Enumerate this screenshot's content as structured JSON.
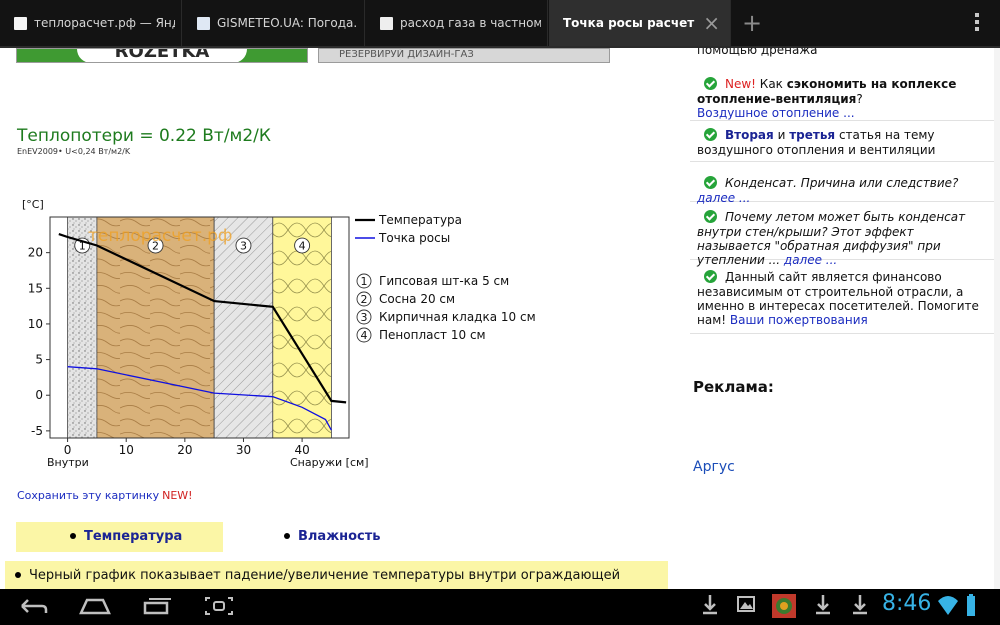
{
  "browser": {
    "tabs": [
      {
        "title": "теплорасчет.рф — Янде...",
        "active": false
      },
      {
        "title": "GISMETEO.UA: Погода...",
        "active": false
      },
      {
        "title": "расход газа в частном...",
        "active": false
      },
      {
        "title": "Точка росы расчет",
        "active": true
      }
    ],
    "close_symbol": "×",
    "new_tab_symbol": "+"
  },
  "banners": {
    "left_text": "ROZETKA",
    "right_text": "РЕЗЕРВИРУЙ ДИЗАЙН-ГАЗ"
  },
  "heat_loss": {
    "title": "Теплопотери = 0.22 Вт/м2/К",
    "subtitle": "EnEV2009• U<0,24 Вт/м2/K"
  },
  "chart_data": {
    "type": "line",
    "ylabel": "[°C]",
    "xlabel_left": "Внутри",
    "xlabel_right": "Снаружи [см]",
    "watermark": "теплорасчет.рф",
    "xlim": [
      -3,
      48
    ],
    "ylim": [
      -6,
      25
    ],
    "x_ticks": [
      0,
      10,
      20,
      30,
      40
    ],
    "y_ticks": [
      -5,
      0,
      5,
      10,
      15,
      20
    ],
    "layers": [
      {
        "number": "1",
        "name": "Гипсовая шт-ка 5 см",
        "from": 0,
        "to": 5
      },
      {
        "number": "2",
        "name": "Сосна 20 см",
        "from": 5,
        "to": 25
      },
      {
        "number": "3",
        "name": "Кирпичная кладка 10 см",
        "from": 25,
        "to": 35
      },
      {
        "number": "4",
        "name": "Пенопласт 10 см",
        "from": 35,
        "to": 45
      }
    ],
    "series": [
      {
        "name": "Температура",
        "color": "#000000",
        "points": [
          [
            -1.5,
            22.6
          ],
          [
            0,
            22.2
          ],
          [
            5,
            21.0
          ],
          [
            25,
            13.2
          ],
          [
            35,
            12.4
          ],
          [
            45,
            -0.8
          ],
          [
            47.5,
            -1.0
          ]
        ]
      },
      {
        "name": "Точка росы",
        "color": "#1010e0",
        "points": [
          [
            0,
            4.0
          ],
          [
            5,
            3.7
          ],
          [
            25,
            0.3
          ],
          [
            35,
            -0.2
          ],
          [
            40,
            -1.7
          ],
          [
            44,
            -3.4
          ],
          [
            45,
            -4.9
          ]
        ]
      }
    ]
  },
  "links": {
    "save_picture": "Сохранить эту картинку",
    "new_badge": "NEW!"
  },
  "mode_tabs": {
    "temperature": "Температура",
    "humidity": "Влажность"
  },
  "note_text": "Черный график показывает падение/увеличение температуры внутри ограждающей",
  "sidebar": {
    "top_text": "помощью дренажа",
    "items": [
      {
        "new": "New!",
        "t1": " Как ",
        "bold": "сэкономить на коплексе отопление-вентиляция",
        "t2": "?",
        "link": "Воздушное отопление ..."
      },
      {
        "b1": "Вторая",
        "t1": " и ",
        "b2": "третья",
        "t2": " статья на тему воздушного отопления и вентиляции"
      },
      {
        "text": "Конденсат. Причина или следствие?",
        "link": "далее ..."
      },
      {
        "text": "Почему летом может быть конденсат внутри стен/крыши? Этот эффект называется \"обратная диффузия\" при утеплении ...",
        "link": "далее ..."
      },
      {
        "text": "Данный сайт является финансово независимым от строительной отрасли, а именно в интересах посетителей. Помогите нам!",
        "link": "Ваши пожертвования"
      }
    ],
    "ads_title": "Реклама:",
    "ads_link": "Аргус"
  },
  "system_bar": {
    "time": "8:46",
    "accent": "#37b3e6"
  }
}
